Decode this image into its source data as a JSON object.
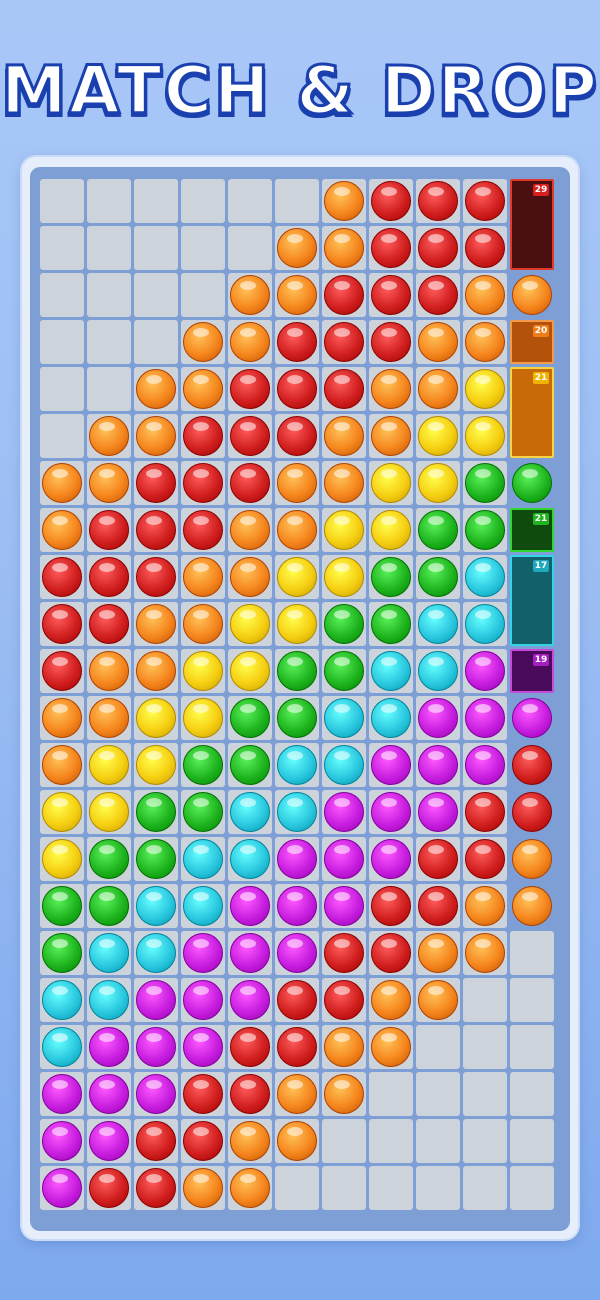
{
  "title": "MATCH & DROP",
  "colors": {
    "O": "#f5861d",
    "R": "#d11f1f",
    "Y": "#f6cf12",
    "G": "#1fb51f",
    "C": "#2bc9e0",
    "M": "#c81ee0"
  },
  "grid_rows": [
    "......ORRR",
    ".....OORRR",
    "....OORRROO",
    "...OORRROO",
    "..OORRROOY",
    ".OORRROOYY",
    "OORRROOYYGG",
    "ORRROOYYGG",
    "RRROOYYGGC",
    "RROOYYGGCC",
    "ROOYYGGCCM",
    "OOYYGGCCMMM",
    "OYYGGCCMMMR",
    "YYGGCCMMMRR",
    "YGGCCMMMRRO",
    "GGCCMMMRROO",
    "GCCMMMRROO.",
    "CCMMMRROO..",
    "CMMMRROO...",
    "MMMRROO....",
    "MMRROO.....",
    "MRROO......"
  ],
  "bins": [
    {
      "count": "29",
      "color": "red",
      "fill": "#4a0f10",
      "border": "#e23a2a",
      "badge": "#d81f1f",
      "fill_ratio": 1.0
    },
    {
      "count": "20",
      "color": "orange",
      "fill": "#b3520a",
      "border": "#f29a4a",
      "badge": "#ef7d1a",
      "fill_ratio": 1.0
    },
    {
      "count": "21",
      "color": "orange",
      "fill": "#c86a08",
      "border": "#f5d544",
      "badge": "#f0b400",
      "fill_ratio": 1.0
    },
    {
      "count": "21",
      "color": "green",
      "fill": "#0f4a0f",
      "border": "#2ed62e",
      "badge": "#1fb51f",
      "fill_ratio": 1.0
    },
    {
      "count": "17",
      "color": "cyan",
      "fill": "#12606a",
      "border": "#33d4e8",
      "badge": "#1fa9bd",
      "fill_ratio": 1.0
    },
    {
      "count": "19",
      "color": "magenta",
      "fill": "#4a0a5c",
      "border": "#c64ad8",
      "badge": "#a41ec0",
      "fill_ratio": 1.0
    }
  ]
}
